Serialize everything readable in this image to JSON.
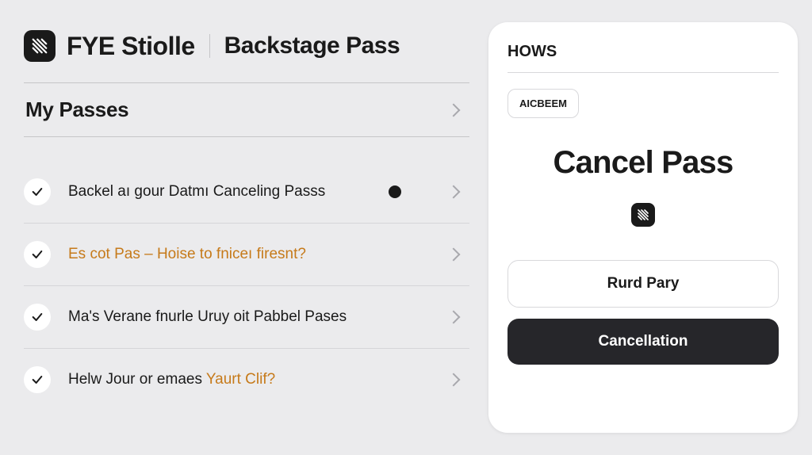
{
  "header": {
    "app_title": "FYE Stiolle",
    "section_title": "Backstage Pass"
  },
  "subheader": {
    "title": "My Passes"
  },
  "list": {
    "items": [
      {
        "text": "Backel aı gour Datmı Canceling Passs",
        "accent": false,
        "dot": true
      },
      {
        "text": "Es cot Pas  –  Hoise to fniceı firesnt?",
        "accent": true,
        "dot": false
      },
      {
        "text": "Ma's Verane fnurle Uruy oit Pabbel Pases",
        "accent": false,
        "dot": false
      },
      {
        "text_prefix": "Helw Jour or emaes ",
        "text_accent": "Yaurt Clif?",
        "mixed": true,
        "dot": false
      }
    ]
  },
  "panel": {
    "header": "HOWS",
    "tag": "AICBEEM",
    "title": "Cancel Pass",
    "button_outline": "Rurd Pary",
    "button_dark": "Cancellation"
  }
}
